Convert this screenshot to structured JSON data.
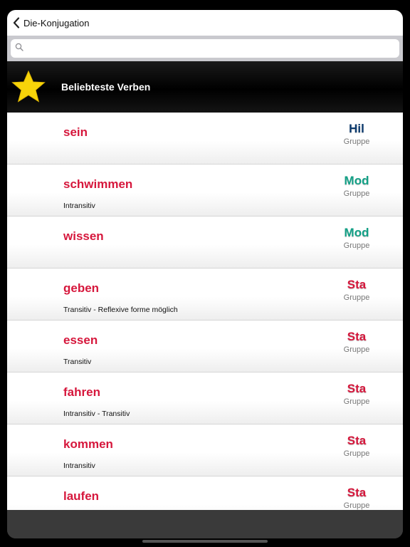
{
  "navbar": {
    "back_label": "Die-Konjugation"
  },
  "search": {
    "value": "",
    "placeholder": ""
  },
  "section": {
    "title": "Beliebteste Verben"
  },
  "verbs": [
    {
      "verb": "sein",
      "type": "",
      "group_code": "Hil",
      "group_label": "Gruppe",
      "group_color": "#0d3b6e"
    },
    {
      "verb": "schwimmen",
      "type": "Intransitiv",
      "group_code": "Mod",
      "group_label": "Gruppe",
      "group_color": "#13a086"
    },
    {
      "verb": "wissen",
      "type": "",
      "group_code": "Mod",
      "group_label": "Gruppe",
      "group_color": "#13a086"
    },
    {
      "verb": "geben",
      "type": "Transitiv - Reflexive forme möglich",
      "group_code": "Sta",
      "group_label": "Gruppe",
      "group_color": "#d6173c"
    },
    {
      "verb": "essen",
      "type": "Transitiv",
      "group_code": "Sta",
      "group_label": "Gruppe",
      "group_color": "#d6173c"
    },
    {
      "verb": "fahren",
      "type": "Intransitiv - Transitiv",
      "group_code": "Sta",
      "group_label": "Gruppe",
      "group_color": "#d6173c"
    },
    {
      "verb": "kommen",
      "type": "Intransitiv",
      "group_code": "Sta",
      "group_label": "Gruppe",
      "group_color": "#d6173c"
    },
    {
      "verb": "laufen",
      "type": "",
      "group_code": "Sta",
      "group_label": "Gruppe",
      "group_color": "#d6173c"
    }
  ],
  "colors": {
    "verb": "#d6173c",
    "star": "#f7d40a",
    "header_bg": "#000000"
  }
}
